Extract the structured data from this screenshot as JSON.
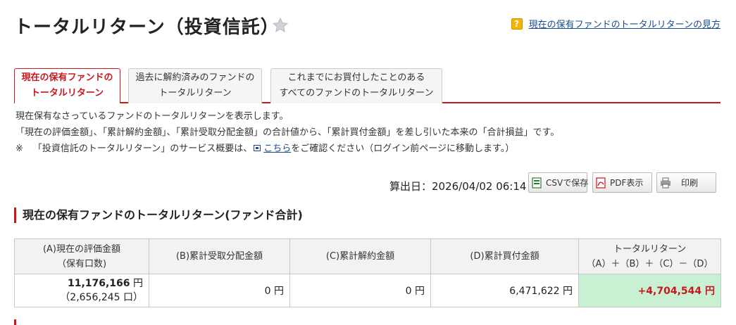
{
  "header": {
    "title": "トータルリターン（投資信託）",
    "help_link": "現在の保有ファンドのトータルリターンの見方"
  },
  "tabs": [
    {
      "line1": "現在の保有ファンドの",
      "line2": "トータルリターン"
    },
    {
      "line1": "過去に解約済みのファンドの",
      "line2": "トータルリターン"
    },
    {
      "line1": "これまでにお買付したことのある",
      "line2": "すべてのファンドのトータルリターン"
    }
  ],
  "description": {
    "line1": "現在保有なさっているファンドのトータルリターンを表示します。",
    "line2": "「現在の評価金額」、「累計解約金額」、「累計受取分配金額」の合計値から、「累計買付金額」を差し引いた本来の「合計損益」です。",
    "note_mark": "※",
    "line3_before": "「投資信託のトータルリターン」のサービス概要は、",
    "line3_link": "こちら",
    "line3_after": "をご確認ください（ログイン前ページに移動します。）"
  },
  "toolbar": {
    "calc_date": "算出日：2026/04/02 06:14",
    "csv_label": "CSVで保存",
    "pdf_label": "PDF表示",
    "print_label": "印刷"
  },
  "section": {
    "heading": "現在の保有ファンドのトータルリターン(ファンド合計)"
  },
  "table": {
    "headers": {
      "a_line1": "(A)現在の評価金額",
      "a_line2": "（保有口数)",
      "b": "(B)累計受取分配金額",
      "c": "(C)累計解約金額",
      "d": "(D)累計買付金額",
      "tr_line1": "トータルリターン",
      "tr_line2": "（A）＋（B）＋（C）－（D）"
    },
    "row": {
      "a_amount": "11,176,166",
      "a_unit": "円",
      "a_units": "（2,656,245 口）",
      "b": "0 円",
      "c": "0 円",
      "d": "6,471,622 円",
      "total": "+4,704,544 円"
    }
  },
  "colors": {
    "accent_red": "#c8171e",
    "positive_bg": "#c8f0d2",
    "link_blue": "#1a4c8f"
  },
  "icons": {
    "favorite": "star-icon",
    "help": "question-icon",
    "external": "external-link-icon",
    "csv": "csv-icon",
    "pdf": "pdf-icon",
    "print": "printer-icon"
  }
}
